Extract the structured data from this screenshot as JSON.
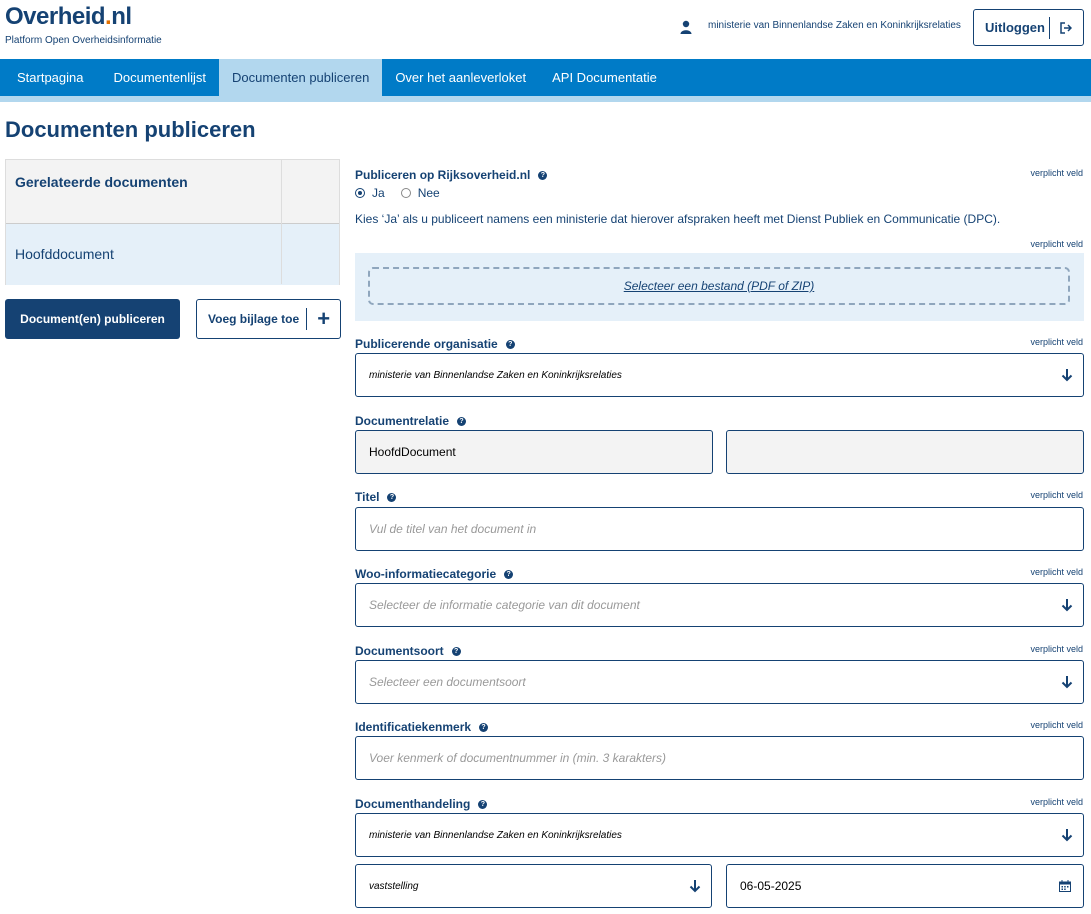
{
  "header": {
    "logo_main": "Overheid",
    "logo_dot": ".",
    "logo_nl": "nl",
    "logo_sub": "Platform Open Overheidsinformatie",
    "user_icon": "user-icon",
    "user_name": "ministerie van Binnenlandse Zaken en Koninkrijksrelaties",
    "logout_label": "Uitloggen",
    "logout_icon": "logout-icon"
  },
  "nav": {
    "items": [
      {
        "label": "Startpagina"
      },
      {
        "label": "Documentenlijst"
      },
      {
        "label": "Documenten publiceren",
        "active": true
      },
      {
        "label": "Over het aanleverloket"
      },
      {
        "label": "API Documentatie"
      }
    ]
  },
  "page": {
    "title": "Documenten publiceren"
  },
  "related": {
    "header": "Gerelateerde documenten",
    "rows": [
      "Hoofddocument"
    ]
  },
  "actions": {
    "publish_label": "Document(en) publiceren",
    "add_attachment_label": "Voeg bijlage toe",
    "add_icon": "plus-icon"
  },
  "form": {
    "required_text": "verplicht veld",
    "publish_rijks": {
      "label": "Publiceren op Rijksoverheid.nl",
      "options": [
        "Ja",
        "Nee"
      ],
      "selected": "Ja",
      "hint": "Kies ‘Ja’ als u publiceert namens een ministerie dat hierover afspraken heeft met Dienst Publiek en Communicatie (DPC)."
    },
    "upload": {
      "label": "Selecteer een bestand (PDF of ZIP)"
    },
    "organisation": {
      "label": "Publicerende organisatie",
      "value": "ministerie van Binnenlandse Zaken en Koninkrijksrelaties"
    },
    "relation": {
      "label": "Documentrelatie",
      "value": "HoofdDocument",
      "value2": ""
    },
    "title": {
      "label": "Titel",
      "placeholder": "Vul de titel van het document in"
    },
    "woo": {
      "label": "Woo-informatiecategorie",
      "placeholder": "Selecteer de informatie categorie van dit document"
    },
    "doctype": {
      "label": "Documentsoort",
      "placeholder": "Selecteer een documentsoort"
    },
    "ident": {
      "label": "Identificatiekenmerk",
      "placeholder": "Voer kenmerk of documentnummer in (min. 3 karakters)"
    },
    "handling": {
      "label": "Documenthandeling",
      "organisation": "ministerie van Binnenlandse Zaken en Koninkrijksrelaties",
      "type": "vaststelling",
      "date": "06-05-2025"
    }
  },
  "colors": {
    "primary": "#154273",
    "nav": "#007bc7",
    "nav_active": "#b2d7ee",
    "accent": "#e17000",
    "light": "#e5f0f9"
  }
}
